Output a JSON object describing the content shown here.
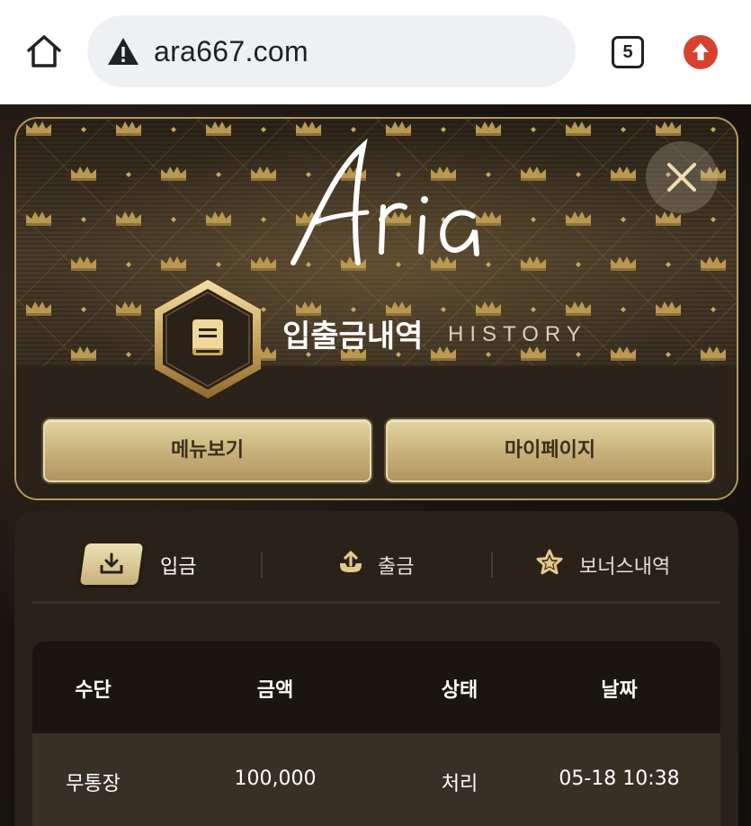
{
  "browser": {
    "url": "ara667.com",
    "tab_count": "5",
    "icons": {
      "home": "home-icon",
      "warning": "not-secure-warning-icon",
      "update": "update-arrow-icon"
    }
  },
  "header": {
    "logo_text": "Aria",
    "title_ko": "입출금내역",
    "title_en": "HISTORY",
    "buttons": {
      "menu": "메뉴보기",
      "mypage": "마이페이지"
    }
  },
  "tabs": [
    {
      "label": "입금",
      "icon": "download-tray-icon",
      "active": true
    },
    {
      "label": "출금",
      "icon": "upload-tray-icon",
      "active": false
    },
    {
      "label": "보너스내역",
      "icon": "star-icon",
      "active": false
    }
  ],
  "table": {
    "columns": [
      "수단",
      "금액",
      "상태",
      "날짜"
    ],
    "rows": [
      {
        "method": "무통장",
        "amount": "100,000",
        "status": "처리",
        "date": "05-18 10:38"
      }
    ]
  },
  "colors": {
    "gold": "#c9b27a",
    "gold_light": "#e2d4a3",
    "dark_bg": "#2a2119",
    "row_bg": "#3a2f24",
    "update_red": "#d9412f"
  }
}
